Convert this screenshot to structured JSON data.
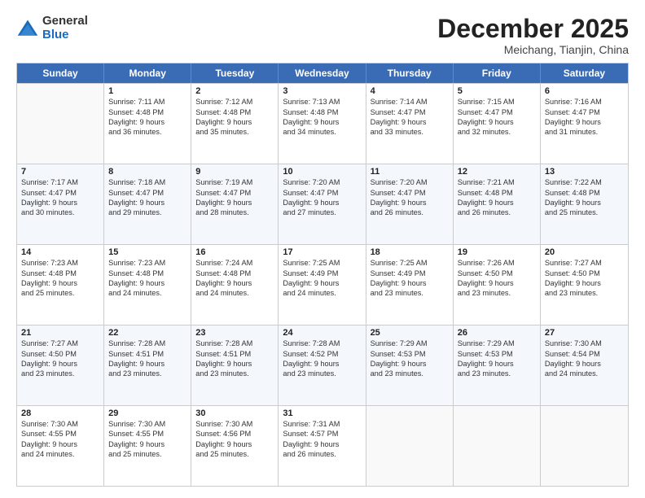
{
  "logo": {
    "general": "General",
    "blue": "Blue"
  },
  "title": "December 2025",
  "subtitle": "Meichang, Tianjin, China",
  "days": [
    "Sunday",
    "Monday",
    "Tuesday",
    "Wednesday",
    "Thursday",
    "Friday",
    "Saturday"
  ],
  "weeks": [
    [
      {
        "day": "",
        "sunrise": "",
        "sunset": "",
        "daylight": ""
      },
      {
        "day": "1",
        "sunrise": "Sunrise: 7:11 AM",
        "sunset": "Sunset: 4:48 PM",
        "daylight": "Daylight: 9 hours and 36 minutes."
      },
      {
        "day": "2",
        "sunrise": "Sunrise: 7:12 AM",
        "sunset": "Sunset: 4:48 PM",
        "daylight": "Daylight: 9 hours and 35 minutes."
      },
      {
        "day": "3",
        "sunrise": "Sunrise: 7:13 AM",
        "sunset": "Sunset: 4:48 PM",
        "daylight": "Daylight: 9 hours and 34 minutes."
      },
      {
        "day": "4",
        "sunrise": "Sunrise: 7:14 AM",
        "sunset": "Sunset: 4:47 PM",
        "daylight": "Daylight: 9 hours and 33 minutes."
      },
      {
        "day": "5",
        "sunrise": "Sunrise: 7:15 AM",
        "sunset": "Sunset: 4:47 PM",
        "daylight": "Daylight: 9 hours and 32 minutes."
      },
      {
        "day": "6",
        "sunrise": "Sunrise: 7:16 AM",
        "sunset": "Sunset: 4:47 PM",
        "daylight": "Daylight: 9 hours and 31 minutes."
      }
    ],
    [
      {
        "day": "7",
        "sunrise": "Sunrise: 7:17 AM",
        "sunset": "Sunset: 4:47 PM",
        "daylight": "Daylight: 9 hours and 30 minutes."
      },
      {
        "day": "8",
        "sunrise": "Sunrise: 7:18 AM",
        "sunset": "Sunset: 4:47 PM",
        "daylight": "Daylight: 9 hours and 29 minutes."
      },
      {
        "day": "9",
        "sunrise": "Sunrise: 7:19 AM",
        "sunset": "Sunset: 4:47 PM",
        "daylight": "Daylight: 9 hours and 28 minutes."
      },
      {
        "day": "10",
        "sunrise": "Sunrise: 7:20 AM",
        "sunset": "Sunset: 4:47 PM",
        "daylight": "Daylight: 9 hours and 27 minutes."
      },
      {
        "day": "11",
        "sunrise": "Sunrise: 7:20 AM",
        "sunset": "Sunset: 4:47 PM",
        "daylight": "Daylight: 9 hours and 26 minutes."
      },
      {
        "day": "12",
        "sunrise": "Sunrise: 7:21 AM",
        "sunset": "Sunset: 4:48 PM",
        "daylight": "Daylight: 9 hours and 26 minutes."
      },
      {
        "day": "13",
        "sunrise": "Sunrise: 7:22 AM",
        "sunset": "Sunset: 4:48 PM",
        "daylight": "Daylight: 9 hours and 25 minutes."
      }
    ],
    [
      {
        "day": "14",
        "sunrise": "Sunrise: 7:23 AM",
        "sunset": "Sunset: 4:48 PM",
        "daylight": "Daylight: 9 hours and 25 minutes."
      },
      {
        "day": "15",
        "sunrise": "Sunrise: 7:23 AM",
        "sunset": "Sunset: 4:48 PM",
        "daylight": "Daylight: 9 hours and 24 minutes."
      },
      {
        "day": "16",
        "sunrise": "Sunrise: 7:24 AM",
        "sunset": "Sunset: 4:48 PM",
        "daylight": "Daylight: 9 hours and 24 minutes."
      },
      {
        "day": "17",
        "sunrise": "Sunrise: 7:25 AM",
        "sunset": "Sunset: 4:49 PM",
        "daylight": "Daylight: 9 hours and 24 minutes."
      },
      {
        "day": "18",
        "sunrise": "Sunrise: 7:25 AM",
        "sunset": "Sunset: 4:49 PM",
        "daylight": "Daylight: 9 hours and 23 minutes."
      },
      {
        "day": "19",
        "sunrise": "Sunrise: 7:26 AM",
        "sunset": "Sunset: 4:50 PM",
        "daylight": "Daylight: 9 hours and 23 minutes."
      },
      {
        "day": "20",
        "sunrise": "Sunrise: 7:27 AM",
        "sunset": "Sunset: 4:50 PM",
        "daylight": "Daylight: 9 hours and 23 minutes."
      }
    ],
    [
      {
        "day": "21",
        "sunrise": "Sunrise: 7:27 AM",
        "sunset": "Sunset: 4:50 PM",
        "daylight": "Daylight: 9 hours and 23 minutes."
      },
      {
        "day": "22",
        "sunrise": "Sunrise: 7:28 AM",
        "sunset": "Sunset: 4:51 PM",
        "daylight": "Daylight: 9 hours and 23 minutes."
      },
      {
        "day": "23",
        "sunrise": "Sunrise: 7:28 AM",
        "sunset": "Sunset: 4:51 PM",
        "daylight": "Daylight: 9 hours and 23 minutes."
      },
      {
        "day": "24",
        "sunrise": "Sunrise: 7:28 AM",
        "sunset": "Sunset: 4:52 PM",
        "daylight": "Daylight: 9 hours and 23 minutes."
      },
      {
        "day": "25",
        "sunrise": "Sunrise: 7:29 AM",
        "sunset": "Sunset: 4:53 PM",
        "daylight": "Daylight: 9 hours and 23 minutes."
      },
      {
        "day": "26",
        "sunrise": "Sunrise: 7:29 AM",
        "sunset": "Sunset: 4:53 PM",
        "daylight": "Daylight: 9 hours and 23 minutes."
      },
      {
        "day": "27",
        "sunrise": "Sunrise: 7:30 AM",
        "sunset": "Sunset: 4:54 PM",
        "daylight": "Daylight: 9 hours and 24 minutes."
      }
    ],
    [
      {
        "day": "28",
        "sunrise": "Sunrise: 7:30 AM",
        "sunset": "Sunset: 4:55 PM",
        "daylight": "Daylight: 9 hours and 24 minutes."
      },
      {
        "day": "29",
        "sunrise": "Sunrise: 7:30 AM",
        "sunset": "Sunset: 4:55 PM",
        "daylight": "Daylight: 9 hours and 25 minutes."
      },
      {
        "day": "30",
        "sunrise": "Sunrise: 7:30 AM",
        "sunset": "Sunset: 4:56 PM",
        "daylight": "Daylight: 9 hours and 25 minutes."
      },
      {
        "day": "31",
        "sunrise": "Sunrise: 7:31 AM",
        "sunset": "Sunset: 4:57 PM",
        "daylight": "Daylight: 9 hours and 26 minutes."
      },
      {
        "day": "",
        "sunrise": "",
        "sunset": "",
        "daylight": ""
      },
      {
        "day": "",
        "sunrise": "",
        "sunset": "",
        "daylight": ""
      },
      {
        "day": "",
        "sunrise": "",
        "sunset": "",
        "daylight": ""
      }
    ]
  ]
}
